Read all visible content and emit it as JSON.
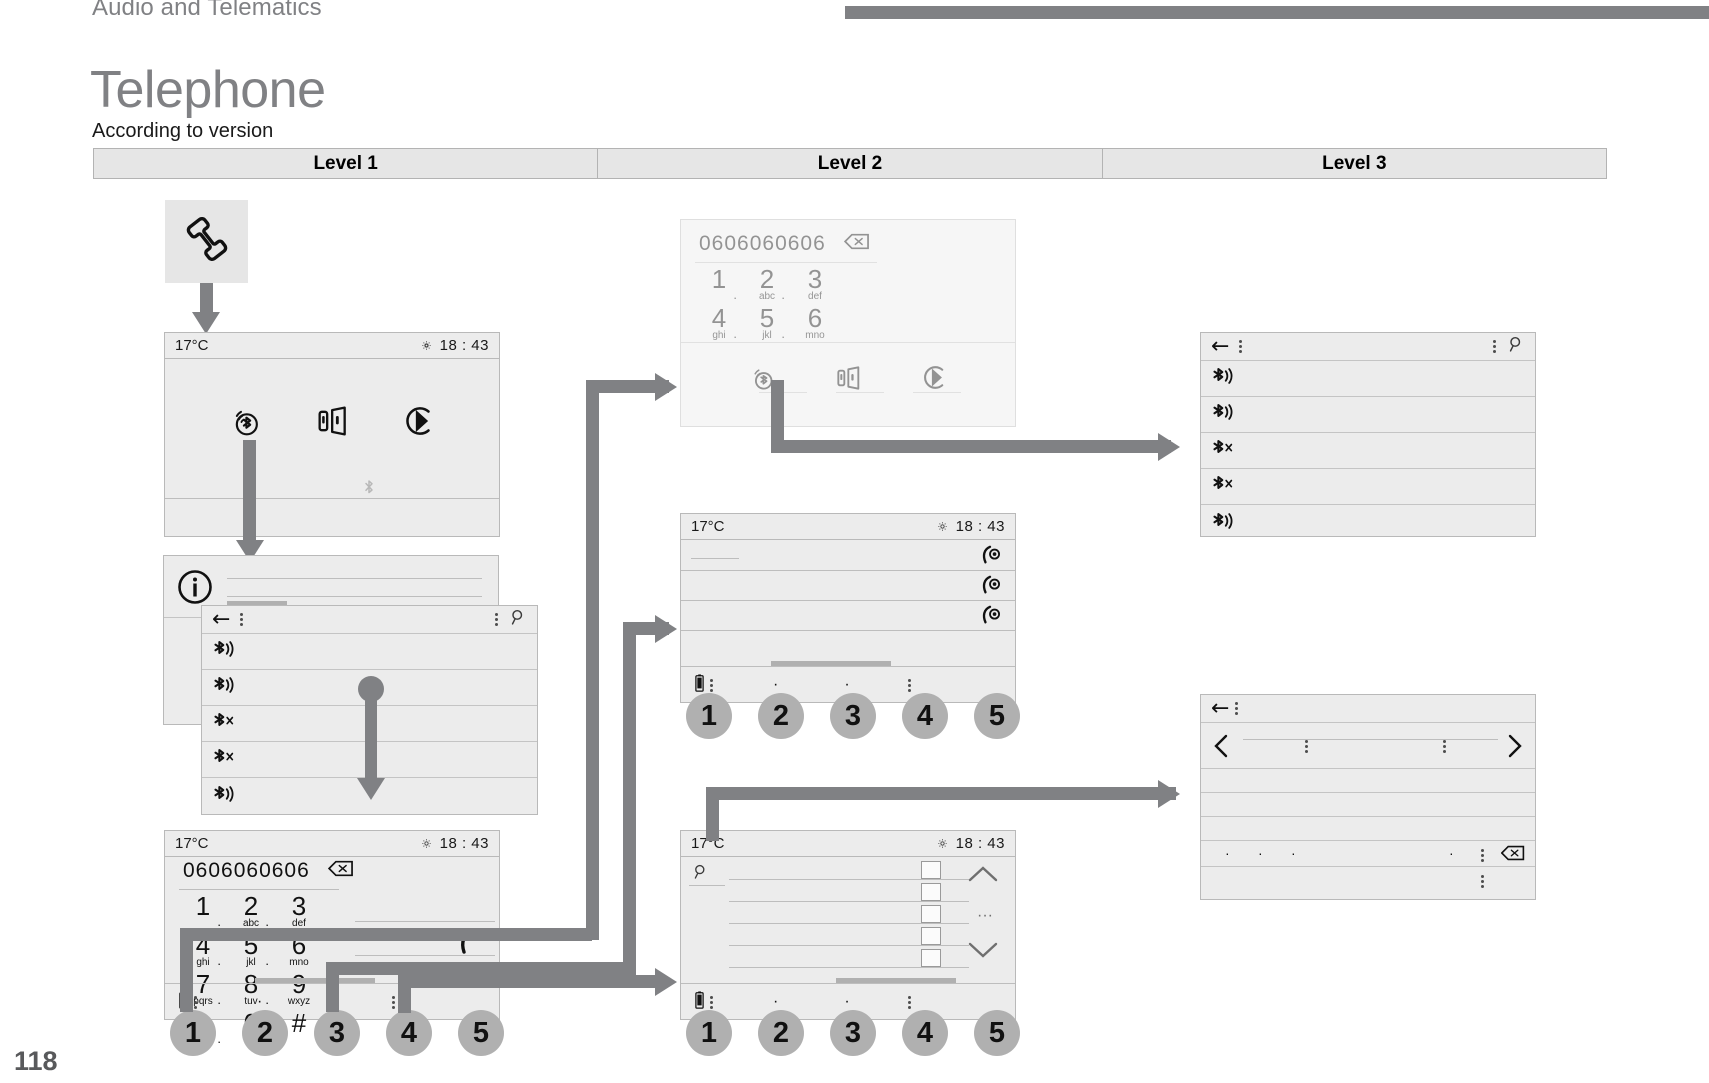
{
  "header": {
    "section": "Audio and Telematics",
    "title": "Telephone",
    "subtitle": "According to version"
  },
  "levels": [
    {
      "label": "Level 1"
    },
    {
      "label": "Level 2"
    },
    {
      "label": "Level 3"
    }
  ],
  "page_number": "118",
  "colors": {
    "screen_bg": "#ececec",
    "screen_border": "#b9b9b9",
    "arrow": "#808184",
    "title": "#808184",
    "level_band": "#e6e6e6",
    "circle": "#b0b0b0"
  },
  "icons": {
    "phone_handset": "phone-handset-icon",
    "bluetooth_connected": "bluetooth-waves-icon",
    "phone_swap": "phone-transfer-icon",
    "play_circle": "play-circle-icon",
    "bluetooth_small": "bluetooth-small-icon",
    "info": "info-circle-icon",
    "back": "back-arrow-icon",
    "kebab": "kebab-menu-icon",
    "search": "search-icon",
    "gear": "gear-icon",
    "backspace": "backspace-icon",
    "call": "call-icon",
    "battery": "battery-icon",
    "chevron_left": "chevron-left-icon",
    "chevron_right": "chevron-right-icon",
    "chevron_up": "chevron-up-icon",
    "chevron_down": "chevron-down-icon",
    "bluetooth_disconnect": "bluetooth-disconnect-icon",
    "contact_call": "contact-call-icon"
  },
  "screens": {
    "home": {
      "status": {
        "temperature": "17°C",
        "time": "18 : 43"
      },
      "tiles": [
        "bluetooth-waves-icon",
        "phone-transfer-icon",
        "play-circle-icon"
      ]
    },
    "dialpad_ghost": {
      "number": "0606060606",
      "keys": [
        {
          "digit": "1",
          "letters": ""
        },
        {
          "digit": "2",
          "letters": "abc"
        },
        {
          "digit": "3",
          "letters": "def"
        },
        {
          "digit": "4",
          "letters": "ghi"
        },
        {
          "digit": "5",
          "letters": "jkl"
        },
        {
          "digit": "6",
          "letters": "mno"
        }
      ],
      "tiles": [
        "bluetooth-waves-icon",
        "phone-transfer-icon",
        "play-circle-icon"
      ]
    },
    "bt_list_level3": {
      "rows": [
        "bluetooth-waves-icon",
        "bluetooth-waves-icon",
        "bluetooth-disconnect-icon",
        "bluetooth-disconnect-icon",
        "bluetooth-waves-icon"
      ]
    },
    "bt_list_level1": {
      "rows": [
        "bluetooth-waves-icon",
        "bluetooth-waves-icon",
        "bluetooth-disconnect-icon",
        "bluetooth-disconnect-icon",
        "bluetooth-waves-icon"
      ]
    },
    "call_log": {
      "status": {
        "temperature": "17°C",
        "time": "18 : 43"
      },
      "rows": [
        "contact-call-icon",
        "contact-call-icon",
        "contact-call-icon"
      ],
      "tabs": [
        "1",
        "2",
        "3",
        "4",
        "5"
      ]
    },
    "dialpad_main": {
      "status": {
        "temperature": "17°C",
        "time": "18 : 43"
      },
      "number": "0606060606",
      "keys": [
        {
          "digit": "1",
          "letters": ""
        },
        {
          "digit": "2",
          "letters": "abc"
        },
        {
          "digit": "3",
          "letters": "def"
        },
        {
          "digit": "4",
          "letters": "ghi"
        },
        {
          "digit": "5",
          "letters": "jkl"
        },
        {
          "digit": "6",
          "letters": "mno"
        },
        {
          "digit": "7",
          "letters": "pqrs"
        },
        {
          "digit": "8",
          "letters": "tuv"
        },
        {
          "digit": "9",
          "letters": "wxyz"
        },
        {
          "digit": "*",
          "letters": ""
        },
        {
          "digit": "0",
          "letters": "+"
        },
        {
          "digit": "#",
          "letters": ""
        }
      ],
      "tabs": [
        "1",
        "2",
        "3",
        "4",
        "5"
      ]
    },
    "contacts": {
      "status": {
        "temperature": "17°C",
        "time": "18 : 43"
      },
      "tabs": [
        "1",
        "2",
        "3",
        "4",
        "5"
      ]
    },
    "message_panel": {
      "rows": 5
    }
  }
}
